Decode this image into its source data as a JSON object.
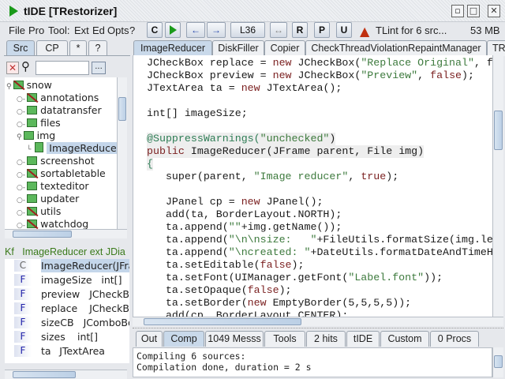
{
  "window": {
    "title": "tIDE [TRestorizer]",
    "controls": [
      "iconify",
      "maximize",
      "close"
    ]
  },
  "menu": [
    "File",
    "Pro",
    "Tool:",
    "Ext",
    "Ed",
    "Opts",
    "?"
  ],
  "toolbar": {
    "compile": "C",
    "run": "",
    "back": "←",
    "forward": "→",
    "line": "L36",
    "swap": "↔",
    "r": "R",
    "p": "P",
    "u": "U",
    "status": "TLint for 6 src...",
    "memory": "53 MB"
  },
  "left_tabs": [
    {
      "label": "Src",
      "selected": true
    },
    {
      "label": "CP"
    },
    {
      "label": "*"
    },
    {
      "label": "?"
    }
  ],
  "search": {
    "value": "",
    "browse": "..."
  },
  "tree": [
    {
      "label": "snow",
      "level": 0,
      "crossed": true
    },
    {
      "label": "annotations",
      "level": 1,
      "crossed": true
    },
    {
      "label": "datatransfer",
      "level": 1
    },
    {
      "label": "files",
      "level": 1
    },
    {
      "label": "img",
      "level": 1,
      "expanded": true
    },
    {
      "label": "ImageReducer",
      "level": 2,
      "selected": true,
      "file": true
    },
    {
      "label": "screenshot",
      "level": 1
    },
    {
      "label": "sortabletable",
      "level": 1,
      "crossed": true
    },
    {
      "label": "texteditor",
      "level": 1
    },
    {
      "label": "updater",
      "level": 1
    },
    {
      "label": "utils",
      "level": 1,
      "crossed": true
    },
    {
      "label": "watchdog",
      "level": 1,
      "crossed": true
    }
  ],
  "structure": {
    "header_kind": "Kf",
    "header": "ImageReducer ext JDia",
    "items": [
      {
        "kind": "C",
        "name": "ImageReducer(JFra",
        "selected": true
      },
      {
        "kind": "F",
        "name": "imageSize",
        "type": "int[]"
      },
      {
        "kind": "F",
        "name": "preview",
        "type": "JCheckBo:"
      },
      {
        "kind": "F",
        "name": "replace",
        "type": "JCheckBo:"
      },
      {
        "kind": "F",
        "name": "sizeCB",
        "type": "JComboBo"
      },
      {
        "kind": "F",
        "name": "sizes",
        "type": "int[]"
      },
      {
        "kind": "F",
        "name": "ta",
        "type": "JTextArea"
      }
    ]
  },
  "editor_tabs": [
    {
      "label": "ImageReducer",
      "selected": true
    },
    {
      "label": "DiskFiller"
    },
    {
      "label": "Copier"
    },
    {
      "label": "CheckThreadViolationRepaintManager"
    },
    {
      "label": "TR"
    }
  ],
  "code": [
    [
      [
        "JCheckBox replace = ",
        ""
      ],
      [
        "new",
        "kw"
      ],
      [
        " JCheckBox(",
        ""
      ],
      [
        "\"Replace Original\"",
        "str"
      ],
      [
        ", f",
        ""
      ]
    ],
    [
      [
        "JCheckBox preview = ",
        ""
      ],
      [
        "new",
        "kw"
      ],
      [
        " JCheckBox(",
        ""
      ],
      [
        "\"Preview\"",
        "str"
      ],
      [
        ", ",
        ""
      ],
      [
        "false",
        "kw"
      ],
      [
        ");",
        ""
      ]
    ],
    [
      [
        "JTextArea ta = ",
        ""
      ],
      [
        "new",
        "kw"
      ],
      [
        " JTextArea();",
        ""
      ]
    ],
    [],
    [
      [
        "int[] imageSize;",
        ""
      ]
    ],
    [],
    [
      [
        "@SuppressWarnings(",
        "ann"
      ],
      [
        "\"unchecked\"",
        "str"
      ],
      [
        ")",
        ""
      ]
    ],
    [
      [
        "public",
        "kw"
      ],
      [
        " ImageReducer(JFrame parent, File img)",
        ""
      ]
    ],
    [
      [
        "{",
        "ann"
      ]
    ],
    [
      [
        "   super(parent, ",
        ""
      ],
      [
        "\"Image reducer\"",
        "str"
      ],
      [
        ", ",
        ""
      ],
      [
        "true",
        "kw"
      ],
      [
        ");",
        ""
      ]
    ],
    [],
    [
      [
        "   JPanel cp = ",
        ""
      ],
      [
        "new",
        "kw"
      ],
      [
        " JPanel();",
        ""
      ]
    ],
    [
      [
        "   add(ta, BorderLayout.NORTH);",
        ""
      ]
    ],
    [
      [
        "   ta.append(",
        ""
      ],
      [
        "\"\"",
        "str"
      ],
      [
        "+img.getName());",
        ""
      ]
    ],
    [
      [
        "   ta.append(",
        ""
      ],
      [
        "\"\\n\\nsize:   \"",
        "str"
      ],
      [
        "+FileUtils.formatSize(img.le",
        ""
      ]
    ],
    [
      [
        "   ta.append(",
        ""
      ],
      [
        "\"\\ncreated: \"",
        "str"
      ],
      [
        "+DateUtils.formatDateAndTimeH",
        ""
      ]
    ],
    [
      [
        "   ta.setEditable(",
        ""
      ],
      [
        "false",
        "kw"
      ],
      [
        ");",
        ""
      ]
    ],
    [
      [
        "   ta.setFont(UIManager.getFont(",
        ""
      ],
      [
        "\"Label.font\"",
        "str"
      ],
      [
        "));",
        ""
      ]
    ],
    [
      [
        "   ta.setOpaque(",
        ""
      ],
      [
        "false",
        "kw"
      ],
      [
        ");",
        ""
      ]
    ],
    [
      [
        "   ta.setBorder(",
        ""
      ],
      [
        "new",
        "kw"
      ],
      [
        " EmptyBorder(5,5,5,5));",
        ""
      ]
    ],
    [
      [
        "   add(cp, BorderLayout.CENTER);",
        ""
      ]
    ]
  ],
  "bottom_tabs": [
    {
      "label": "Out"
    },
    {
      "label": "Comp",
      "selected": true
    },
    {
      "label": "1049 Messs"
    },
    {
      "label": "Tools"
    },
    {
      "label": "2 hits"
    },
    {
      "label": "tIDE"
    },
    {
      "label": "Custom"
    },
    {
      "label": "0 Procs"
    }
  ],
  "console": [
    "Compiling 6 sources:",
    "Compilation done, duration = 2 s"
  ]
}
